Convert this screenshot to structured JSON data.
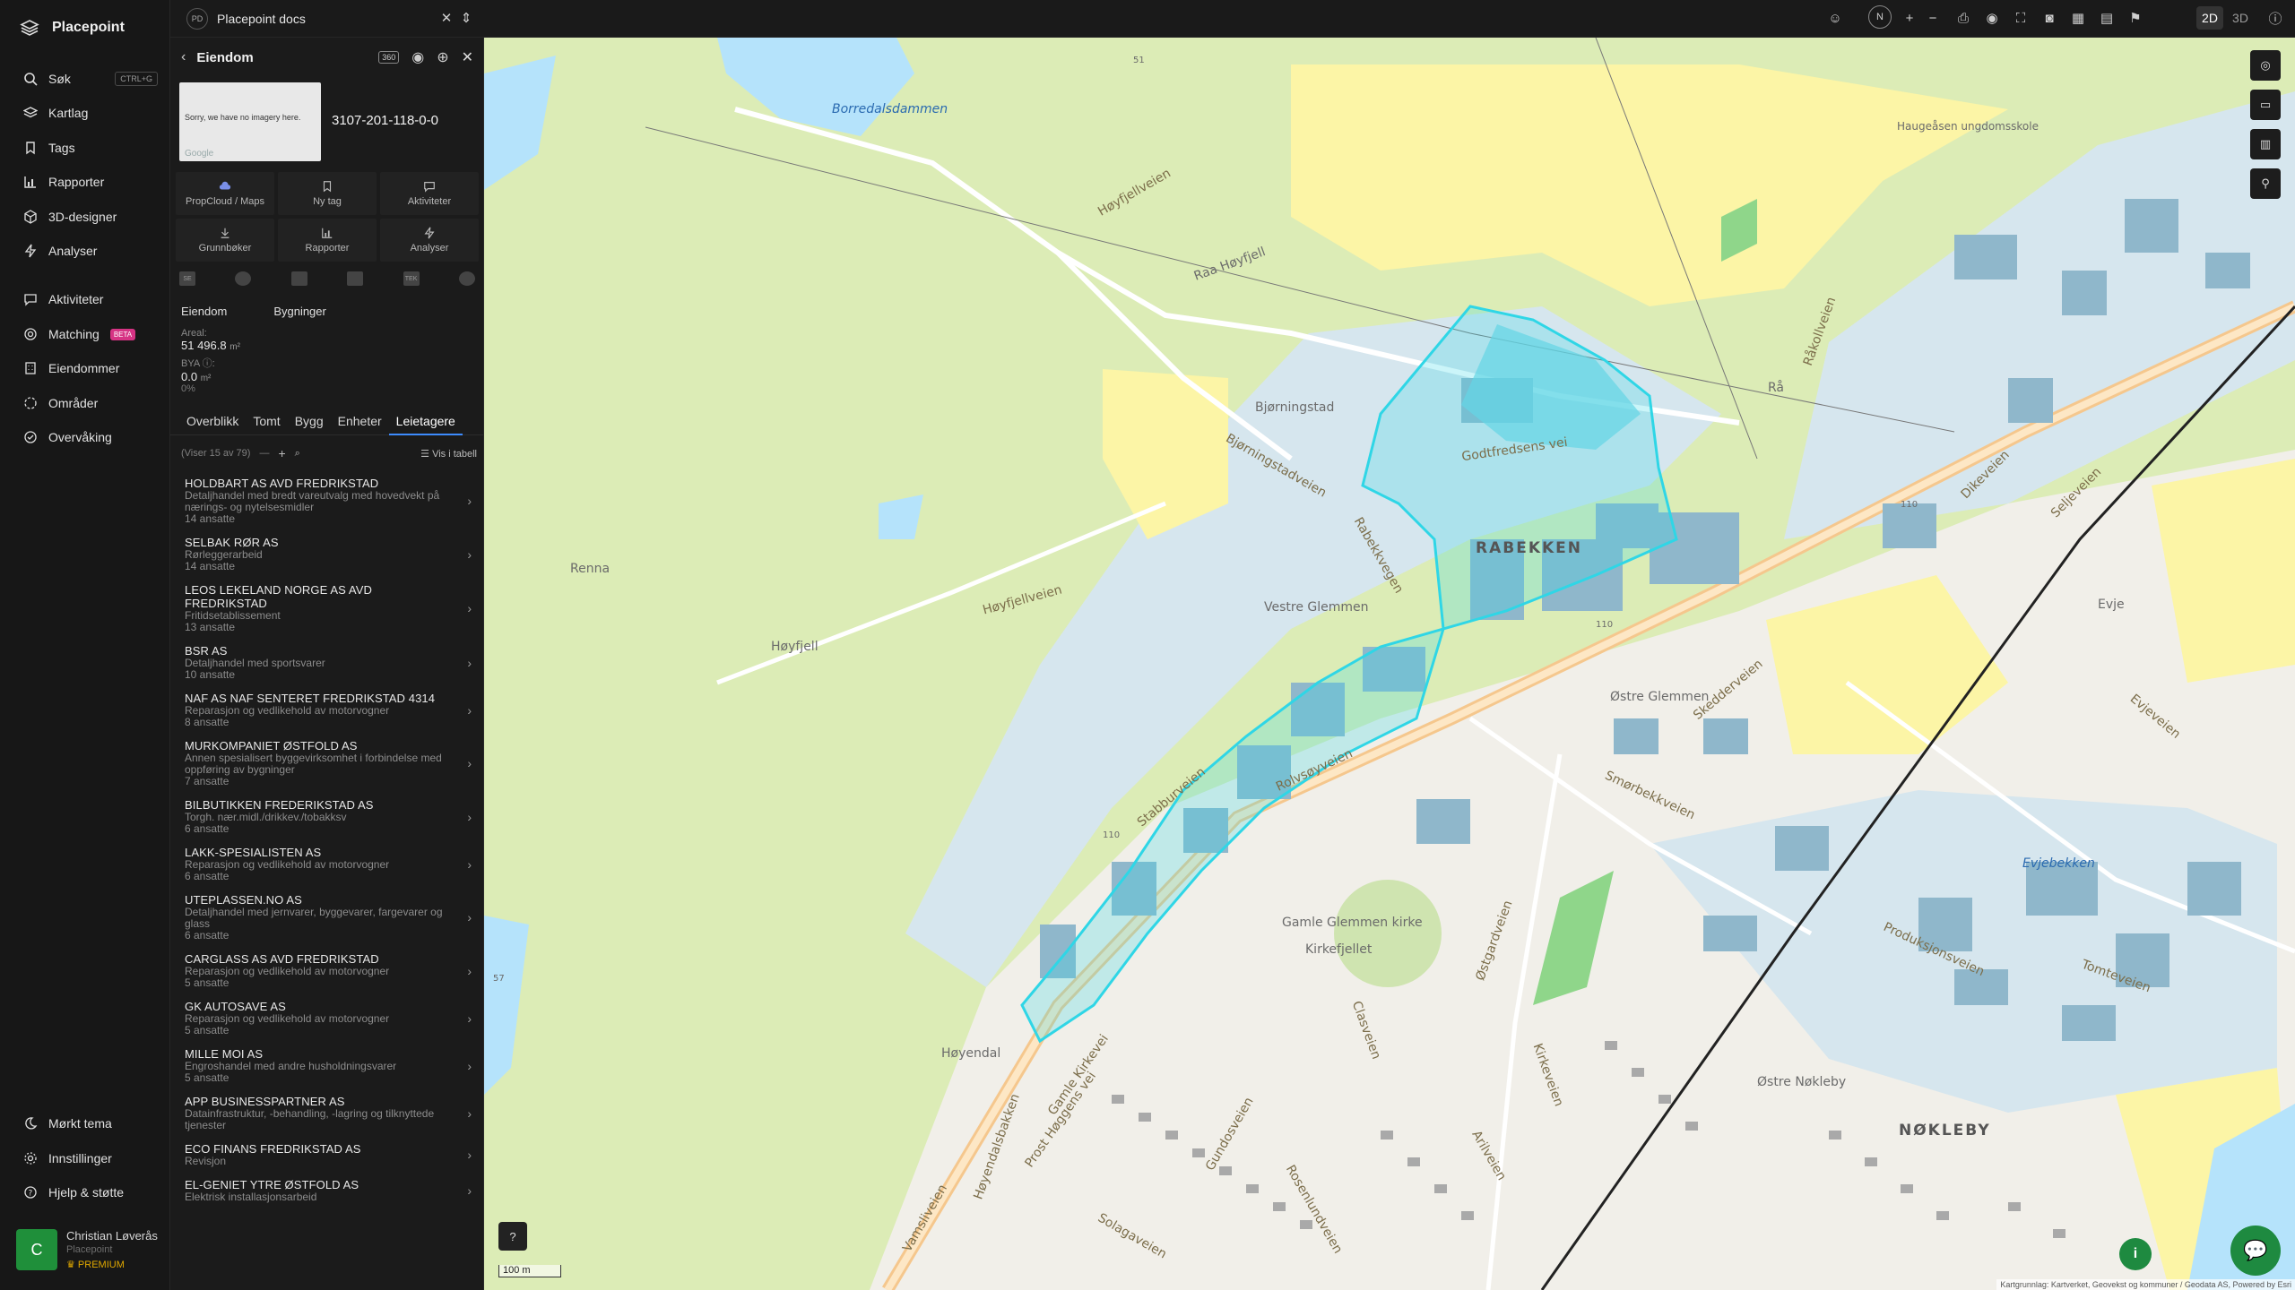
{
  "brand": {
    "name": "Placepoint"
  },
  "nav": {
    "items": [
      {
        "label": "Søk",
        "shortcut": "CTRL+G",
        "icon": "search-icon"
      },
      {
        "label": "Kartlag",
        "icon": "layers-icon"
      },
      {
        "label": "Tags",
        "icon": "bookmark-icon"
      },
      {
        "label": "Rapporter",
        "icon": "chart-icon"
      },
      {
        "label": "3D-designer",
        "icon": "cube-icon"
      },
      {
        "label": "Analyser",
        "icon": "bolt-icon"
      },
      {
        "label": "Aktiviteter",
        "icon": "chat-icon"
      },
      {
        "label": "Matching",
        "badge": "BETA",
        "icon": "target-icon"
      },
      {
        "label": "Eiendommer",
        "icon": "building-icon"
      },
      {
        "label": "Områder",
        "icon": "area-icon"
      },
      {
        "label": "Overvåking",
        "icon": "monitor-icon"
      }
    ],
    "bottom": [
      {
        "label": "Mørkt tema",
        "icon": "moon-icon"
      },
      {
        "label": "Innstillinger",
        "icon": "gear-icon"
      },
      {
        "label": "Hjelp & støtte",
        "icon": "help-icon"
      }
    ]
  },
  "user": {
    "initial": "C",
    "name": "Christian Løverås",
    "org": "Placepoint",
    "tier": "PREMIUM"
  },
  "topbar": {
    "workspace_badge": "PD",
    "workspace": "Placepoint docs",
    "compass": "N",
    "modes": [
      "2D",
      "3D"
    ],
    "active_mode": "2D"
  },
  "panel": {
    "title": "Eiendom",
    "thumbnail": {
      "message": "Sorry, we have no imagery here.",
      "provider": "Google"
    },
    "property_id": "3107-201-118-0-0",
    "actions": [
      {
        "label": "PropCloud / Maps",
        "icon": "cloud-icon"
      },
      {
        "label": "Ny tag",
        "icon": "bookmark-icon"
      },
      {
        "label": "Aktiviteter",
        "icon": "chat-icon"
      },
      {
        "label": "Grunnbøker",
        "icon": "download-icon"
      },
      {
        "label": "Rapporter",
        "icon": "chart-icon"
      },
      {
        "label": "Analyser",
        "icon": "bolt-icon"
      }
    ],
    "layer_tags": [
      "SE",
      "",
      "",
      "",
      "TEK",
      ""
    ],
    "subtabs": [
      "Eiendom",
      "Bygninger"
    ],
    "stats": {
      "area_label": "Areal:",
      "area_value": "51 496.8",
      "area_unit": "m²",
      "bya_label": "BYA ⓘ:",
      "bya_value": "0.0",
      "bya_unit": "m²",
      "bya_pct": "0%"
    },
    "tabs": [
      "Overblikk",
      "Tomt",
      "Bygg",
      "Enheter",
      "Leietagere"
    ],
    "active_tab": "Leietagere",
    "list_info": "(Viser 15 av 79)",
    "list_dash": "—",
    "table_toggle": "Vis i tabell",
    "tenants": [
      {
        "name": "HOLDBART AS AVD FREDRIKSTAD",
        "desc": "Detaljhandel med bredt vareutvalg med hovedvekt på nærings- og nytelsesmidler",
        "count": "14 ansatte"
      },
      {
        "name": "SELBAK RØR AS",
        "desc": "Rørleggerarbeid",
        "count": "14 ansatte"
      },
      {
        "name": "LEOS LEKELAND NORGE AS AVD FREDRIKSTAD",
        "desc": "Fritidsetablissement",
        "count": "13 ansatte"
      },
      {
        "name": "BSR AS",
        "desc": "Detaljhandel med sportsvarer",
        "count": "10 ansatte"
      },
      {
        "name": "NAF AS NAF SENTERET FREDRIKSTAD 4314",
        "desc": "Reparasjon og vedlikehold av motorvogner",
        "count": "8 ansatte"
      },
      {
        "name": "MURKOMPANIET ØSTFOLD AS",
        "desc": "Annen spesialisert byggevirksomhet i forbindelse med oppføring av bygninger",
        "count": "7 ansatte"
      },
      {
        "name": "BILBUTIKKEN FREDERIKSTAD AS",
        "desc": "Torgh. nær.midl./drikkev./tobakksv",
        "count": "6 ansatte"
      },
      {
        "name": "LAKK-SPESIALISTEN AS",
        "desc": "Reparasjon og vedlikehold av motorvogner",
        "count": "6 ansatte"
      },
      {
        "name": "UTEPLASSEN.NO AS",
        "desc": "Detaljhandel med jernvarer, byggevarer, fargevarer og glass",
        "count": "6 ansatte"
      },
      {
        "name": "CARGLASS AS AVD FREDRIKSTAD",
        "desc": "Reparasjon og vedlikehold av motorvogner",
        "count": "5 ansatte"
      },
      {
        "name": "GK AUTOSAVE AS",
        "desc": "Reparasjon og vedlikehold av motorvogner",
        "count": "5 ansatte"
      },
      {
        "name": "MILLE MOI AS",
        "desc": "Engroshandel med andre husholdningsvarer",
        "count": "5 ansatte"
      },
      {
        "name": "APP BUSINESSPARTNER AS",
        "desc": "Datainfrastruktur, -behandling, -lagring og tilknyttede tjenester",
        "count": ""
      },
      {
        "name": "ECO FINANS FREDRIKSTAD AS",
        "desc": "Revisjon",
        "count": ""
      },
      {
        "name": "EL-GENIET YTRE ØSTFOLD AS",
        "desc": "Elektrisk installasjonsarbeid",
        "count": ""
      }
    ]
  },
  "map": {
    "labels": {
      "borredalsdammen": "Borredalsdammen",
      "hoyfjellveien1": "Høyfjellveien",
      "hoyfjellveien2": "Høyfjellveien",
      "raa_hoyfjell": "Raa Høyfjell",
      "bjorningstad": "Bjørningstad",
      "bjorningstadveien": "Bjørningstadveien",
      "godtfredsens": "Godtfredsens vei",
      "rabekkenvegen": "Rabekkvegen",
      "rabekken": "RABEKKEN",
      "vestre_glemmen": "Vestre Glemmen",
      "renna": "Renna",
      "hoyfjell": "Høyfjell",
      "stabburveien": "Stabburveien",
      "rolvsoyveien": "Rolvsøyveien",
      "ostre_glemmen": "Østre Glemmen",
      "skedderveien": "Skedderveien",
      "smorbekkveien": "Smørbekkveien",
      "gamle_glemmen": "Gamle Glemmen kirke",
      "kirkefjellet": "Kirkefjellet",
      "haugeasen": "Haugeåsen ungdomsskole",
      "raa": "Rå",
      "rakollveien": "Råkollveien",
      "dikeveien": "Dikeveien",
      "seljeveien": "Seljeveien",
      "evje": "Evje",
      "evjeveien": "Evjeveien",
      "evjebekken": "Evjebekken",
      "produksjonsveien": "Produksjonsveien",
      "tomteveien": "Tomteveien",
      "nokleby": "NØKLEBY",
      "ostre_nokleby": "Østre Nøkleby",
      "ostgardveien": "Østgardveien",
      "clasveien": "Clasveien",
      "gamle_kirkevei": "Gamle Kirkevei",
      "hoyendal": "Høyendal",
      "prost_hoggens_vei": "Prost Høggens vei",
      "vamsveien": "Vamsliveien",
      "arilveien": "Arilveien",
      "kirkeveien": "Kirkeveien",
      "road_110a": "110",
      "road_110b": "110",
      "road_110c": "110",
      "hoyendalsbakken": "Høyendalsbakken",
      "gundosveien": "Gundosveien",
      "solagaveien": "Solagaveien",
      "rosenlundveien": "Rosenlundveien",
      "elevation_51": "51",
      "elevation_57": "57"
    },
    "scale": "100 m",
    "attribution": "Kartgrunnlag: Kartverket, Geovekst og kommuner / Geodata AS, Powered by Esri",
    "colors": {
      "forest": "#d8ebb0",
      "field": "#fdf6a8",
      "industrial": "#d4e6f1",
      "building": "#8fb7cb",
      "selection": "#2fd6e6",
      "water": "#b5e3fb",
      "road": "#f6c98d"
    }
  }
}
